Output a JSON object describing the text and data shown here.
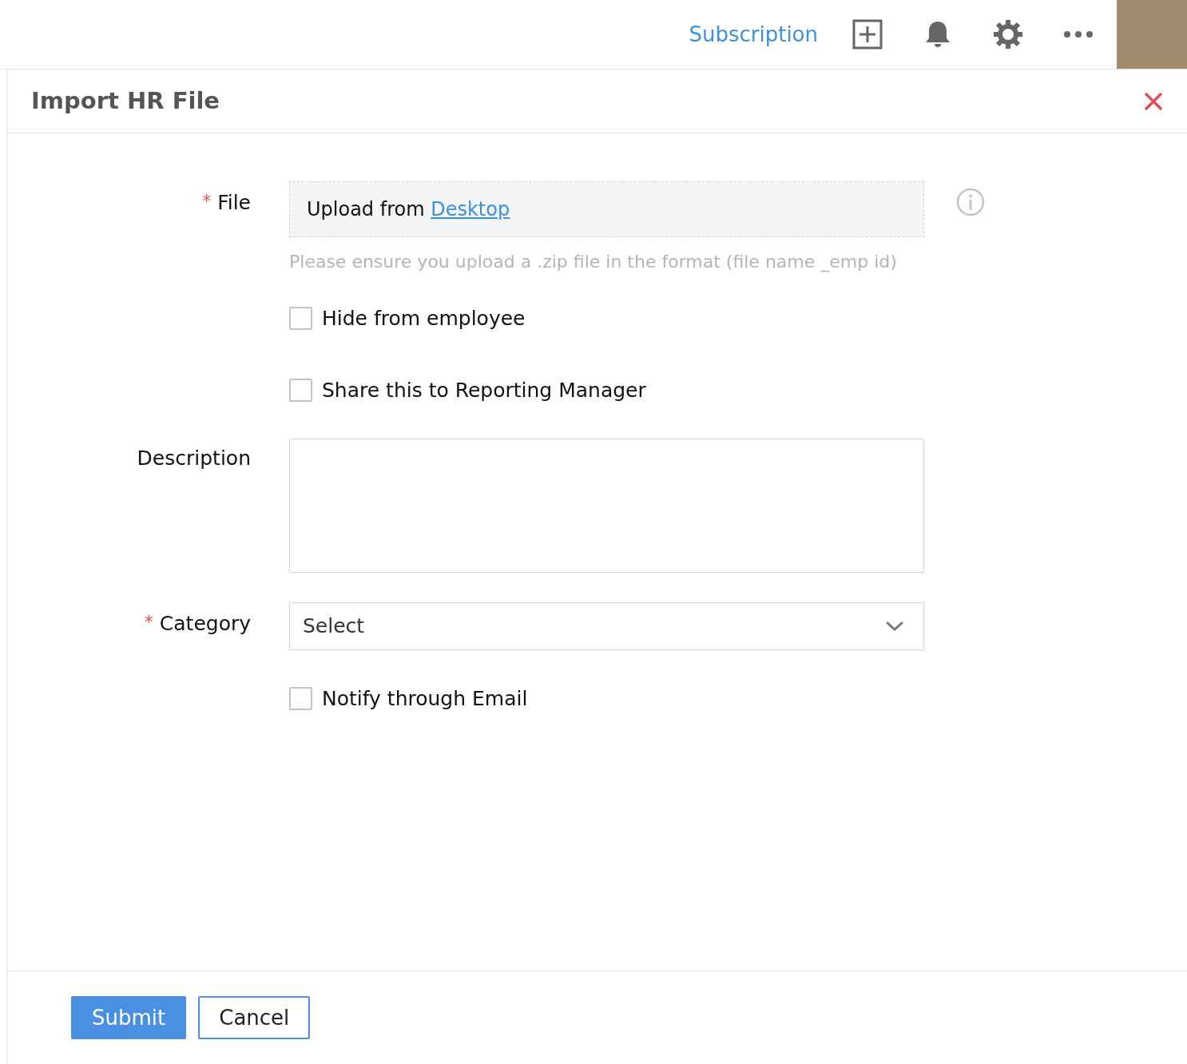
{
  "topbar": {
    "link": "Subscription"
  },
  "dialog": {
    "title": "Import HR File"
  },
  "fields": [
    {
      "kind": "file",
      "label": "File",
      "required_mark": "*",
      "prefix": "Upload from ",
      "link": "Desktop",
      "hint": "Please ensure you upload a .zip file in the format (file name _emp id)"
    },
    {
      "kind": "checkbox",
      "text": "Hide from employee",
      "checked": false
    },
    {
      "kind": "checkbox",
      "text": "Share this to Reporting Manager",
      "checked": false
    },
    {
      "kind": "textarea",
      "label": "Description"
    },
    {
      "kind": "select",
      "label": "Category",
      "required_mark": "*",
      "value": "Select"
    },
    {
      "kind": "checkbox",
      "text": "Notify through Email",
      "checked": false
    }
  ],
  "buttons": [
    {
      "label": "Submit",
      "kind": "primary"
    },
    {
      "label": "Cancel",
      "kind": "secondary"
    }
  ]
}
